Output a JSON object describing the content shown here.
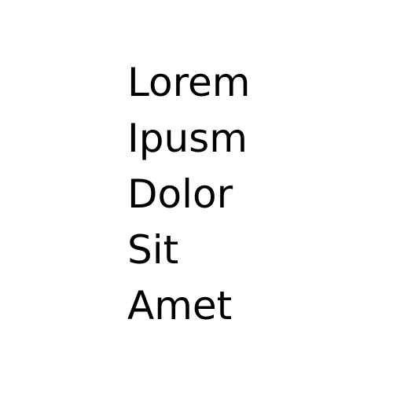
{
  "words": [
    "Lorem",
    "Ipusm",
    "Dolor",
    "Sit",
    "Amet"
  ],
  "colors": {
    "background": "#ffffff",
    "text": "#000000"
  }
}
